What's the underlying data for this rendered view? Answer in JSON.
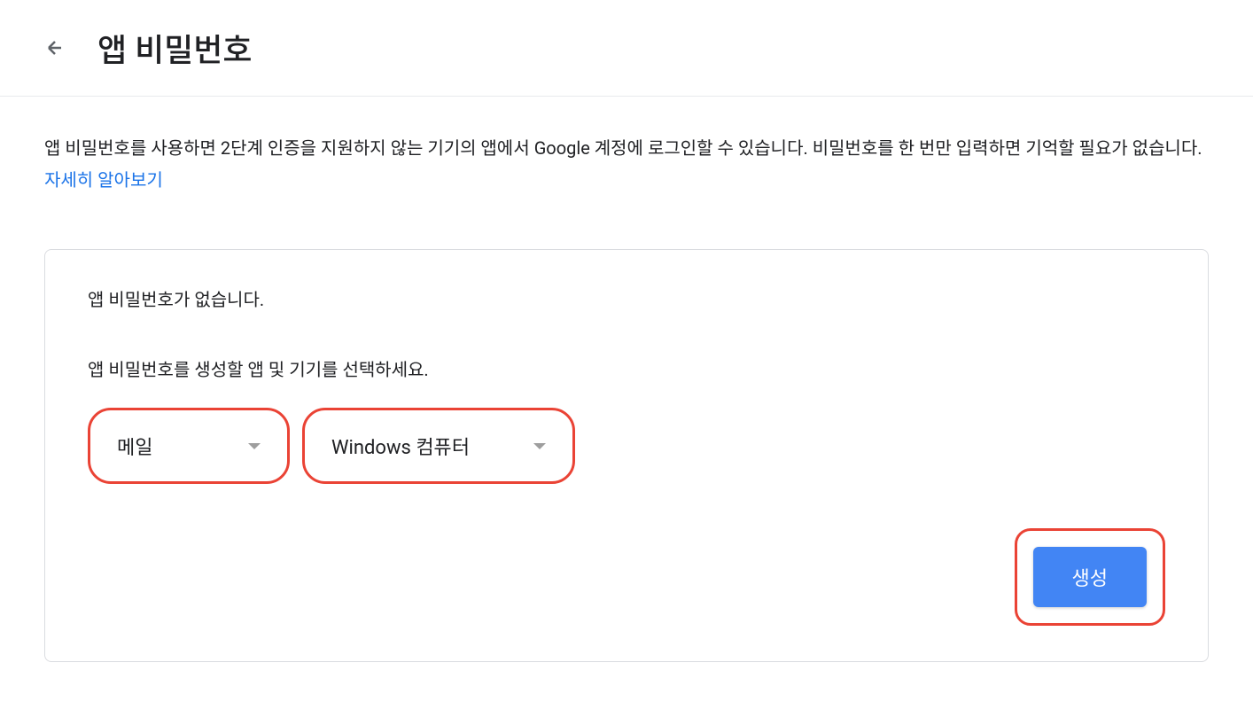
{
  "header": {
    "title": "앱 비밀번호"
  },
  "description": {
    "text": "앱 비밀번호를 사용하면 2단계 인증을 지원하지 않는 기기의 앱에서 Google 계정에 로그인할 수 있습니다. 비밀번호를 한 번만 입력하면 기억할 필요가 없습니다. ",
    "link": "자세히 알아보기"
  },
  "card": {
    "status": "앱 비밀번호가 없습니다.",
    "instruction": "앱 비밀번호를 생성할 앱 및 기기를 선택하세요.",
    "app_select": "메일",
    "device_select": "Windows 컴퓨터",
    "generate_button": "생성"
  }
}
